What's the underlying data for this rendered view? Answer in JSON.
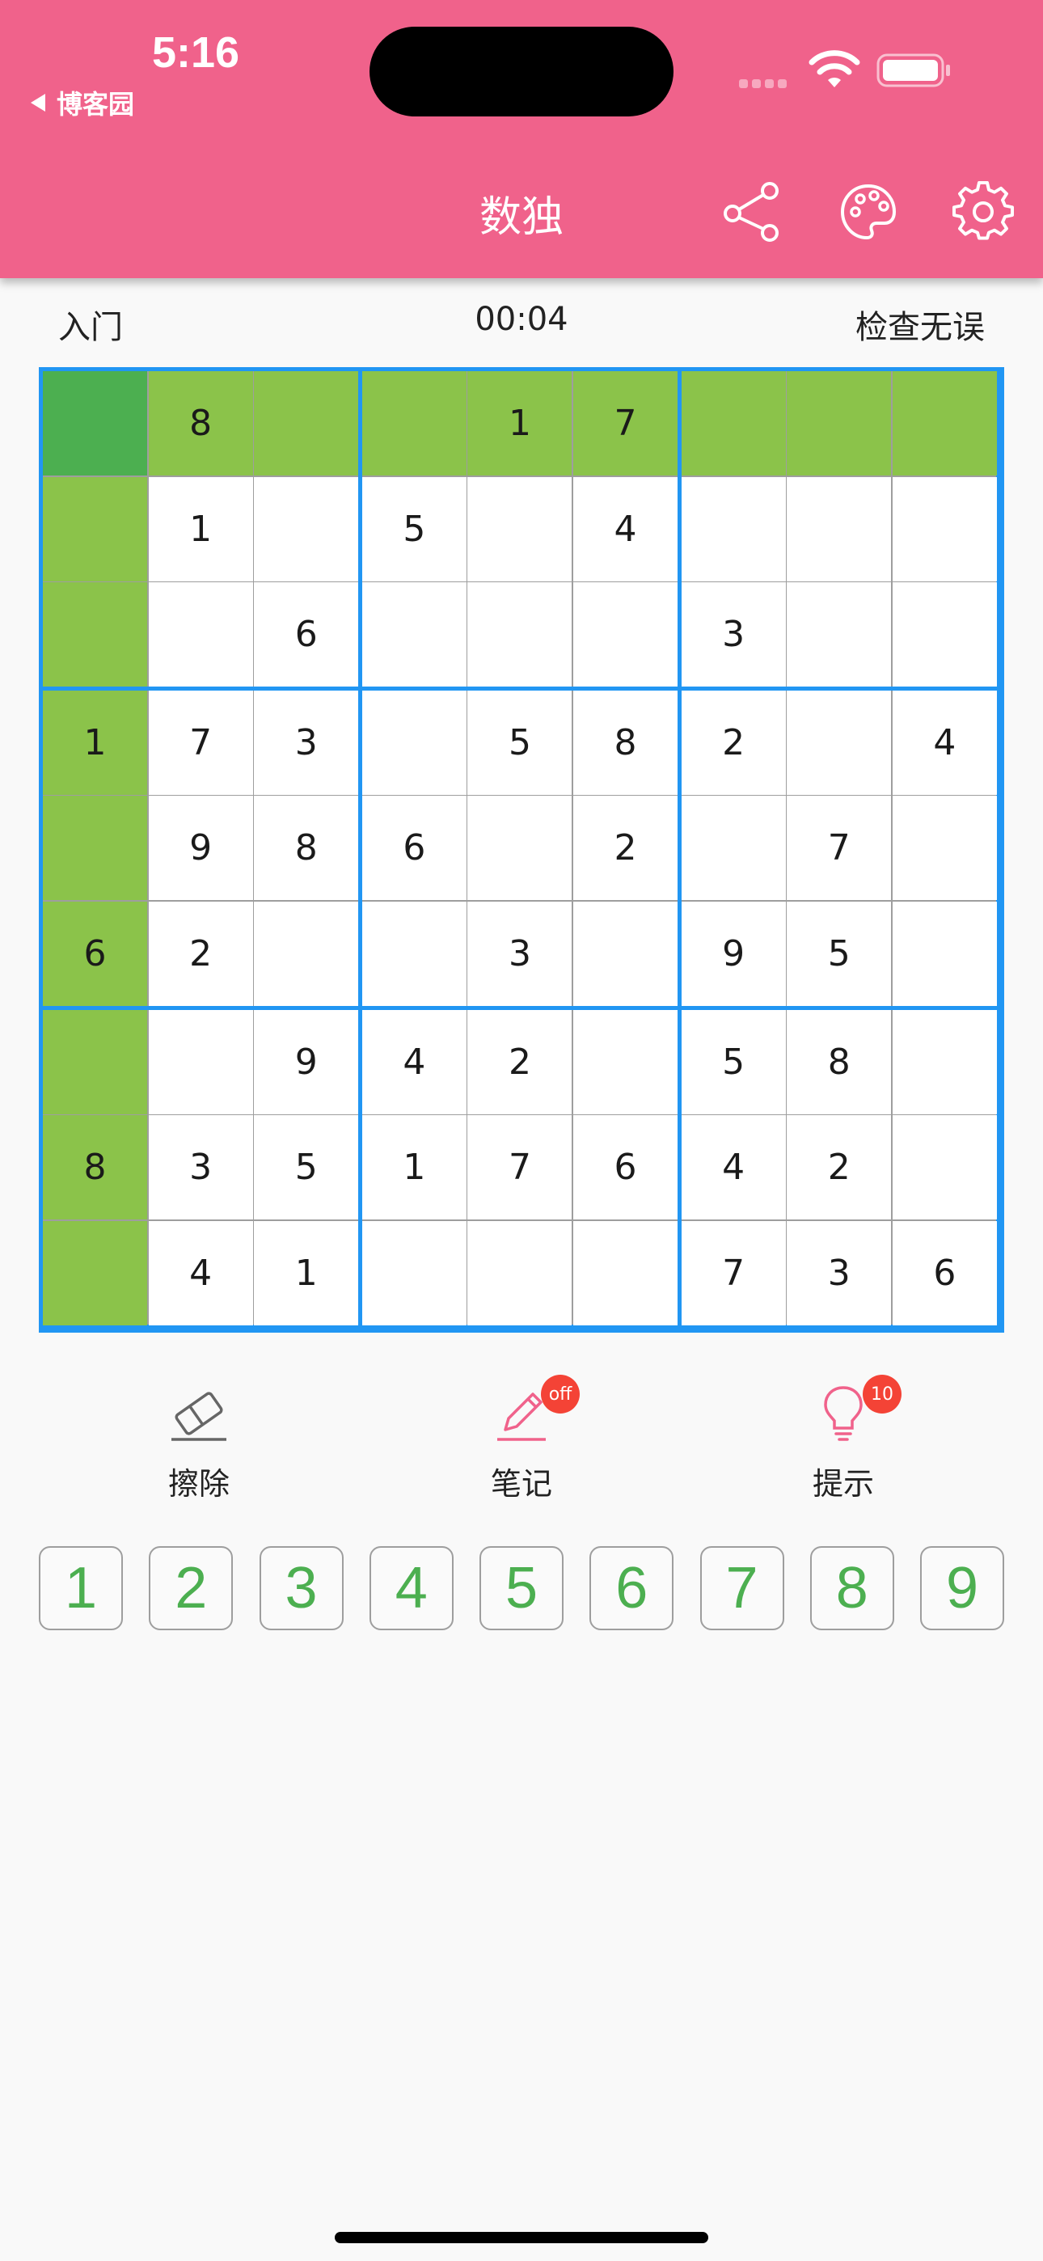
{
  "status_bar": {
    "time": "5:16",
    "back_app": "博客园"
  },
  "header": {
    "title": "数独",
    "icons": [
      "share-icon",
      "palette-icon",
      "settings-icon"
    ],
    "background_color": "#f0628b"
  },
  "info": {
    "difficulty": "入门",
    "timer": "00:04",
    "check_status": "检查无误"
  },
  "board": {
    "cells": [
      [
        "",
        "8",
        "",
        "",
        "1",
        "7",
        "",
        "",
        ""
      ],
      [
        "",
        "1",
        "",
        "5",
        "",
        "4",
        "",
        "",
        ""
      ],
      [
        "",
        "",
        "6",
        "",
        "",
        "",
        "3",
        "",
        ""
      ],
      [
        "1",
        "7",
        "3",
        "",
        "5",
        "8",
        "2",
        "",
        "4"
      ],
      [
        "",
        "9",
        "8",
        "6",
        "",
        "2",
        "",
        "7",
        ""
      ],
      [
        "6",
        "2",
        "",
        "",
        "3",
        "",
        "9",
        "5",
        ""
      ],
      [
        "",
        "",
        "9",
        "4",
        "2",
        "",
        "5",
        "8",
        ""
      ],
      [
        "8",
        "3",
        "5",
        "1",
        "7",
        "6",
        "4",
        "2",
        ""
      ],
      [
        "",
        "4",
        "1",
        "",
        "",
        "",
        "7",
        "3",
        "6"
      ]
    ],
    "selected_cell": {
      "row": 0,
      "col": 0
    },
    "colors": {
      "selected": "#4caf50",
      "highlight": "#8bc34a",
      "block_border": "#2196f3",
      "cell_border": "#9e9e9e",
      "cell_bg": "#ffffff"
    }
  },
  "tools": {
    "erase": {
      "label": "擦除",
      "icon": "eraser-icon"
    },
    "notes": {
      "label": "笔记",
      "icon": "pencil-icon",
      "badge": "off"
    },
    "hint": {
      "label": "提示",
      "icon": "lightbulb-icon",
      "badge": "10"
    }
  },
  "numpad": {
    "keys": [
      "1",
      "2",
      "3",
      "4",
      "5",
      "6",
      "7",
      "8",
      "9"
    ],
    "color": "#4caf50"
  }
}
